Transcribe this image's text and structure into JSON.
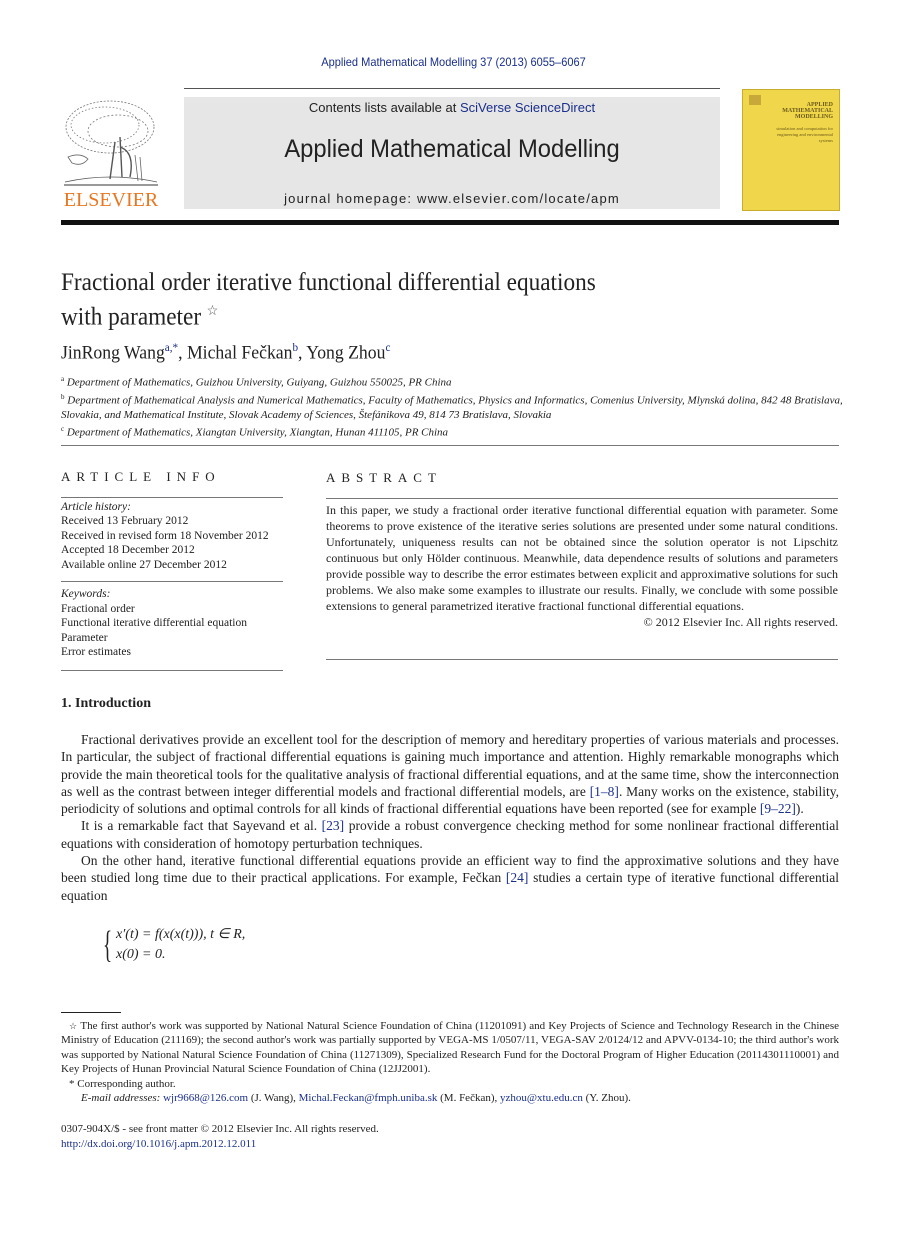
{
  "header": {
    "running_head": "Applied Mathematical Modelling 37 (2013) 6055–6067",
    "contents_prefix": "Contents lists available at ",
    "contents_link": "SciVerse ScienceDirect",
    "journal_name": "Applied Mathematical Modelling",
    "homepage": "journal homepage: www.elsevier.com/locate/apm",
    "publisher_logo_text": "ELSEVIER",
    "cover": {
      "title_lines": [
        "APPLIED",
        "MATHEMATICAL",
        "MODELLING"
      ],
      "subtitle": "simulation and computation for engineering and environmental systems",
      "color": "#f0d64a"
    }
  },
  "article": {
    "title_line1": "Fractional order iterative functional differential equations",
    "title_line2": "with parameter",
    "title_mark": "☆",
    "authors": [
      {
        "name": "JinRong Wang",
        "sup": "a,*"
      },
      {
        "name": "Michal Fečkan",
        "sup": "b"
      },
      {
        "name": "Yong Zhou",
        "sup": "c"
      }
    ],
    "affiliations": [
      {
        "mark": "a",
        "text": "Department of Mathematics, Guizhou University, Guiyang, Guizhou 550025, PR China"
      },
      {
        "mark": "b",
        "text": "Department of Mathematical Analysis and Numerical Mathematics, Faculty of Mathematics, Physics and Informatics, Comenius University, Mlynská dolina, 842 48 Bratislava, Slovakia, and Mathematical Institute, Slovak Academy of Sciences, Štefánikova 49, 814 73 Bratislava, Slovakia"
      },
      {
        "mark": "c",
        "text": "Department of Mathematics, Xiangtan University, Xiangtan, Hunan 411105, PR China"
      }
    ]
  },
  "article_info": {
    "heading": "ARTICLE INFO",
    "history_label": "Article history:",
    "history": [
      "Received 13 February 2012",
      "Received in revised form 18 November 2012",
      "Accepted 18 December 2012",
      "Available online 27 December 2012"
    ],
    "keywords_label": "Keywords:",
    "keywords": [
      "Fractional order",
      "Functional iterative differential equation",
      "Parameter",
      "Error estimates"
    ]
  },
  "abstract": {
    "heading": "ABSTRACT",
    "text": "In this paper, we study a fractional order iterative functional differential equation with parameter. Some theorems to prove existence of the iterative series solutions are presented under some natural conditions. Unfortunately, uniqueness results can not be obtained since the solution operator is not Lipschitz continuous but only Hölder continuous. Meanwhile, data dependence results of solutions and parameters provide possible way to describe the error estimates between explicit and approximative solutions for such problems. We also make some examples to illustrate our results. Finally, we conclude with some possible extensions to general parametrized iterative fractional functional differential equations.",
    "copyright": "© 2012 Elsevier Inc. All rights reserved."
  },
  "introduction": {
    "heading": "1. Introduction",
    "p1_a": "Fractional derivatives provide an excellent tool for the description of memory and hereditary properties of various materials and processes. In particular, the subject of fractional differential equations is gaining much importance and attention. Highly remarkable monographs which provide the main theoretical tools for the qualitative analysis of fractional differential equations, and at the same time, show the interconnection as well as the contrast between integer differential models and fractional differential models, are ",
    "p1_ref1": "[1–8]",
    "p1_b": ". Many works on the existence, stability, periodicity of solutions and optimal controls for all kinds of fractional differential equations have been reported (see for example ",
    "p1_ref2": "[9–22]",
    "p1_c": ").",
    "p2_a": "It is a remarkable fact that Sayevand et al. ",
    "p2_ref": "[23]",
    "p2_b": " provide a robust convergence checking method for some nonlinear fractional differential equations with consideration of homotopy perturbation techniques.",
    "p3_a": "On the other hand, iterative functional differential equations provide an efficient way to find the approximative solutions and they have been studied long time due to their practical applications. For example, Fečkan ",
    "p3_ref": "[24]",
    "p3_b": " studies a certain type of iterative functional differential equation",
    "equation_line1": "x′(t) = f(x(x(t))),    t ∈ R,",
    "equation_line2": "x(0) = 0."
  },
  "footnotes": {
    "funding_mark": "☆",
    "funding": "The first author's work was supported by National Natural Science Foundation of China (11201091) and Key Projects of Science and Technology Research in the Chinese Ministry of Education (211169); the second author's work was partially supported by VEGA-MS 1/0507/11, VEGA-SAV 2/0124/12 and APVV-0134-10; the third author's work was supported by National Natural Science Foundation of China (11271309), Specialized Research Fund for the Doctoral Program of Higher Education (20114301110001) and Key Projects of Hunan Provincial Natural Science Foundation of China (12JJ2001).",
    "corresponding_mark": "*",
    "corresponding": "Corresponding author.",
    "email_label": "E-mail addresses:",
    "emails": [
      {
        "address": "wjr9668@126.com",
        "who": " (J. Wang), "
      },
      {
        "address": "Michal.Feckan@fmph.uniba.sk",
        "who": " (M. Fečkan), "
      },
      {
        "address": "yzhou@xtu.edu.cn",
        "who": " (Y. Zhou)."
      }
    ]
  },
  "front_matter": {
    "issn_line": "0307-904X/$ - see front matter © 2012 Elsevier Inc. All rights reserved.",
    "doi": "http://dx.doi.org/10.1016/j.apm.2012.12.011"
  }
}
